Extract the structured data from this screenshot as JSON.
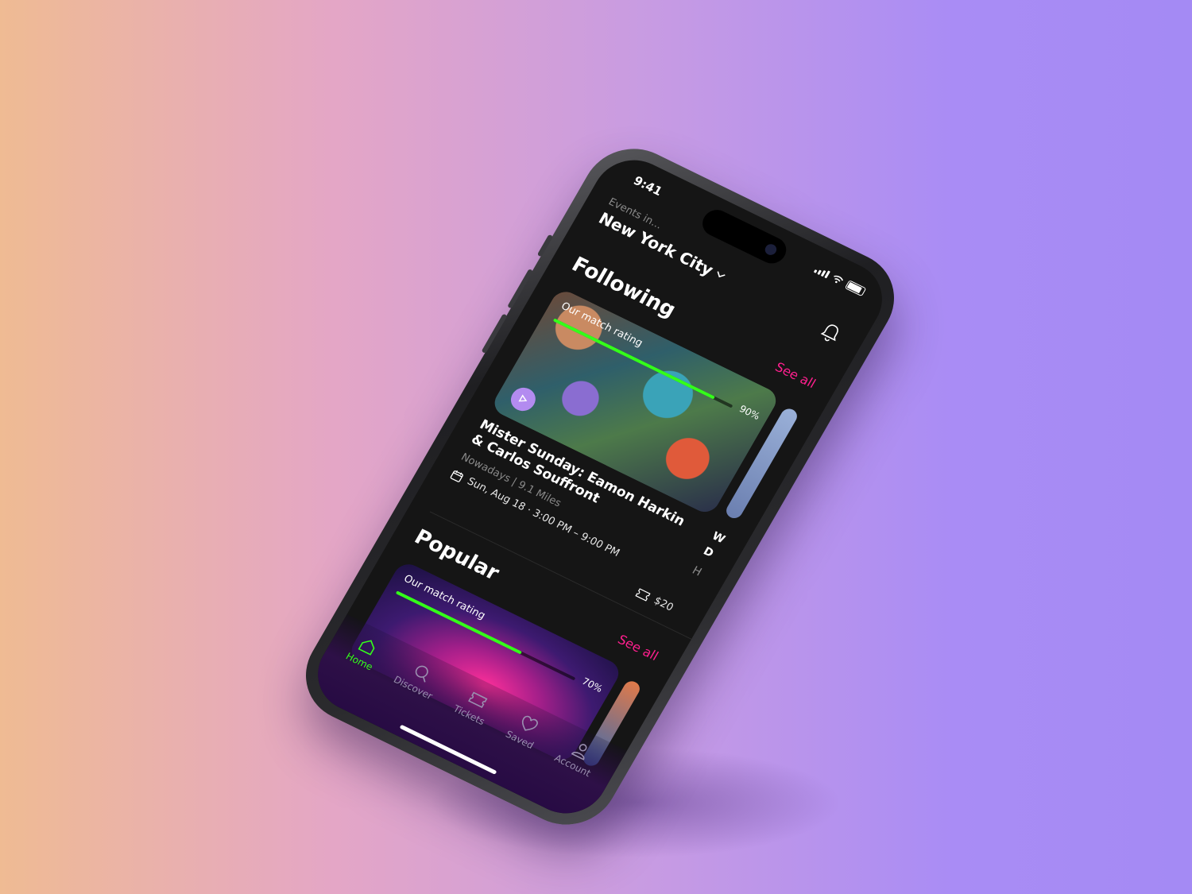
{
  "status": {
    "time": "9:41"
  },
  "header": {
    "events_in": "Events in...",
    "city": "New York City"
  },
  "following": {
    "title": "Following",
    "see_all": "See all",
    "card": {
      "match_label": "Our match rating",
      "match_percent": "90%",
      "match_value": 0.9,
      "title": "Mister Sunday: Eamon Harkin & Carlos Souffront",
      "venue_distance": "Nowadays | 9.1 Miles",
      "datetime": "Sun, Aug 18 · 3:00 PM – 9:00 PM",
      "price": "$20"
    },
    "peek_letters": [
      "W",
      "D",
      "H"
    ]
  },
  "popular": {
    "title": "Popular",
    "see_all": "See all",
    "card": {
      "match_label": "Our match rating",
      "match_percent": "70%",
      "match_value": 0.7
    }
  },
  "tabs": [
    {
      "label": "Home",
      "icon": "home-icon",
      "active": true
    },
    {
      "label": "Discover",
      "icon": "search-icon",
      "active": false
    },
    {
      "label": "Tickets",
      "icon": "ticket-icon",
      "active": false
    },
    {
      "label": "Saved",
      "icon": "heart-icon",
      "active": false
    },
    {
      "label": "Account",
      "icon": "user-icon",
      "active": false
    }
  ],
  "colors": {
    "accent_green": "#34ff1a",
    "accent_pink": "#ff1f8e",
    "screen_bg": "#151515"
  }
}
